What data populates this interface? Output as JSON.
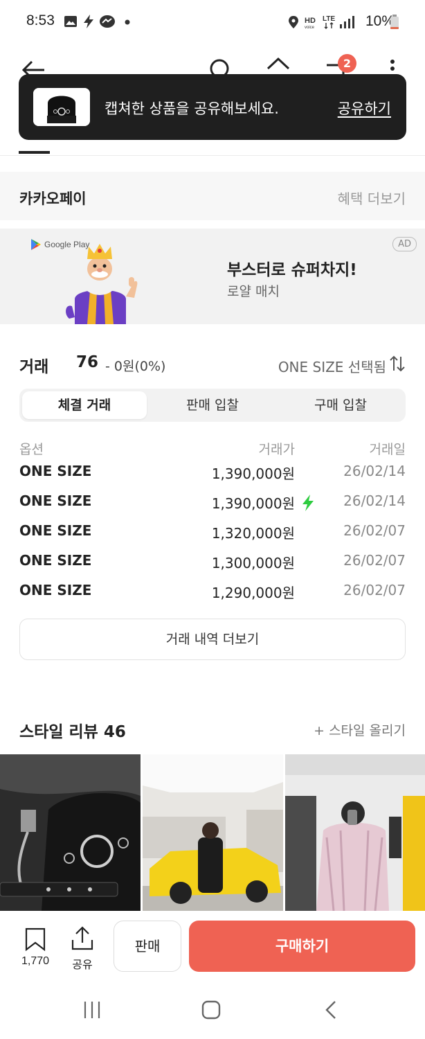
{
  "status_bar": {
    "time": "8:53",
    "battery": "10%",
    "network": "LTE",
    "icons": [
      "gallery-icon",
      "bolt-icon",
      "messenger-icon",
      "dot-icon",
      "location-icon",
      "hd-voice-icon",
      "lte-icon",
      "signal-icon",
      "battery-icon"
    ]
  },
  "header": {
    "icons": [
      "back-arrow-icon",
      "search-icon",
      "home-icon",
      "cart-icon",
      "more-vertical-icon"
    ],
    "cart_count": "2"
  },
  "toast": {
    "message": "캡쳐한 상품을 공유해보세요.",
    "action": "공유하기"
  },
  "kakaopay": {
    "name": "카카오페이",
    "more": "혜택 더보기"
  },
  "ad": {
    "store": "Google Play",
    "headline": "부스터로 슈퍼차지!",
    "subtitle": "로얄 매치",
    "badge": "AD"
  },
  "transactions": {
    "title": "거래",
    "count": "76",
    "change": "- 0원(0%)",
    "size_selected": "ONE SIZE 선택됨",
    "tabs": [
      {
        "label": "체결 거래",
        "active": true
      },
      {
        "label": "판매 입찰",
        "active": false
      },
      {
        "label": "구매 입찰",
        "active": false
      }
    ],
    "columns": [
      "옵션",
      "거래가",
      "거래일"
    ],
    "rows": [
      {
        "option": "ONE SIZE",
        "price": "1,390,000원",
        "date": "26/02/14",
        "fast": false
      },
      {
        "option": "ONE SIZE",
        "price": "1,390,000원",
        "date": "26/02/14",
        "fast": true
      },
      {
        "option": "ONE SIZE",
        "price": "1,320,000원",
        "date": "26/02/07",
        "fast": false
      },
      {
        "option": "ONE SIZE",
        "price": "1,300,000원",
        "date": "26/02/07",
        "fast": false
      },
      {
        "option": "ONE SIZE",
        "price": "1,290,000원",
        "date": "26/02/07",
        "fast": false
      }
    ],
    "more_button": "거래 내역 더보기"
  },
  "style_review": {
    "title": "스타일 리뷰 46",
    "upload": "+ 스타일 올리기"
  },
  "bottom_bar": {
    "bookmark_count": "1,770",
    "share_label": "공유",
    "sell_label": "판매",
    "buy_label": "구매하기"
  },
  "colors": {
    "accent": "#ef6253",
    "toast_bg": "#1f1f1f",
    "fast_bolt": "#2ecc40"
  }
}
